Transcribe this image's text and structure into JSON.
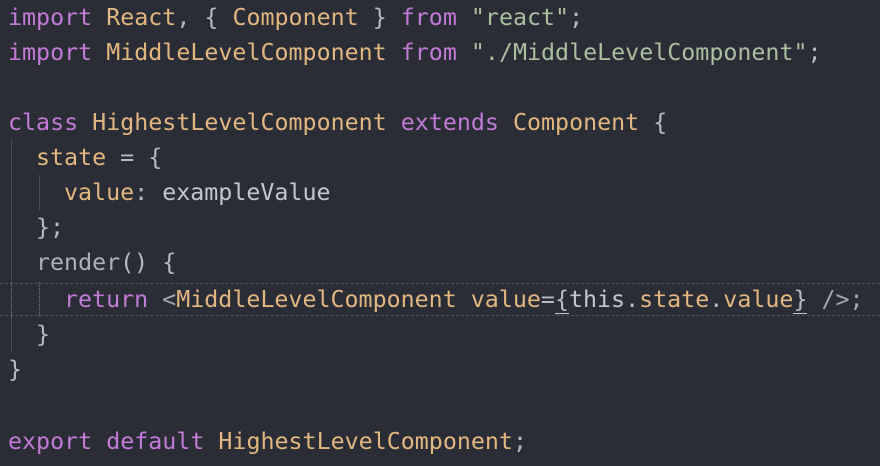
{
  "editor": {
    "lines": [
      {
        "indent": 0,
        "tokens": [
          {
            "t": "import",
            "k": "kw"
          },
          {
            "t": " ",
            "k": "plain"
          },
          {
            "t": "React",
            "k": "cls"
          },
          {
            "t": ", { ",
            "k": "punc"
          },
          {
            "t": "Component",
            "k": "cls"
          },
          {
            "t": " } ",
            "k": "punc"
          },
          {
            "t": "from",
            "k": "kw"
          },
          {
            "t": " ",
            "k": "plain"
          },
          {
            "t": "\"react\"",
            "k": "str"
          },
          {
            "t": ";",
            "k": "punc"
          }
        ]
      },
      {
        "indent": 0,
        "tokens": [
          {
            "t": "import",
            "k": "kw"
          },
          {
            "t": " ",
            "k": "plain"
          },
          {
            "t": "MiddleLevelComponent",
            "k": "cls"
          },
          {
            "t": " ",
            "k": "plain"
          },
          {
            "t": "from",
            "k": "kw"
          },
          {
            "t": " ",
            "k": "plain"
          },
          {
            "t": "\"./MiddleLevelComponent\"",
            "k": "str"
          },
          {
            "t": ";",
            "k": "punc"
          }
        ]
      },
      {
        "indent": 0,
        "tokens": []
      },
      {
        "indent": 0,
        "tokens": [
          {
            "t": "class",
            "k": "kw"
          },
          {
            "t": " ",
            "k": "plain"
          },
          {
            "t": "HighestLevelComponent",
            "k": "cls"
          },
          {
            "t": " ",
            "k": "plain"
          },
          {
            "t": "extends",
            "k": "kw"
          },
          {
            "t": " ",
            "k": "plain"
          },
          {
            "t": "Component",
            "k": "cls"
          },
          {
            "t": " {",
            "k": "punc"
          }
        ]
      },
      {
        "indent": 1,
        "tokens": [
          {
            "t": "state",
            "k": "prop"
          },
          {
            "t": " = {",
            "k": "punc"
          }
        ]
      },
      {
        "indent": 2,
        "tokens": [
          {
            "t": "value",
            "k": "prop"
          },
          {
            "t": ": ",
            "k": "punc"
          },
          {
            "t": "exampleValue",
            "k": "plain"
          }
        ]
      },
      {
        "indent": 1,
        "tokens": [
          {
            "t": "};",
            "k": "punc"
          }
        ]
      },
      {
        "indent": 1,
        "tokens": [
          {
            "t": "render",
            "k": "fn"
          },
          {
            "t": "() {",
            "k": "punc"
          }
        ]
      },
      {
        "indent": 2,
        "active": true,
        "tokens": [
          {
            "t": "return",
            "k": "kw"
          },
          {
            "t": " <",
            "k": "tag"
          },
          {
            "t": "MiddleLevelComponent",
            "k": "cls"
          },
          {
            "t": " ",
            "k": "plain"
          },
          {
            "t": "value",
            "k": "attr"
          },
          {
            "t": "=",
            "k": "punc"
          },
          {
            "t": "{",
            "k": "punc",
            "hl": true
          },
          {
            "t": "this",
            "k": "this"
          },
          {
            "t": ".",
            "k": "punc"
          },
          {
            "t": "state",
            "k": "prop"
          },
          {
            "t": ".",
            "k": "punc"
          },
          {
            "t": "value",
            "k": "prop"
          },
          {
            "t": "}",
            "k": "punc",
            "hl": true
          },
          {
            "t": " />;",
            "k": "tag"
          }
        ]
      },
      {
        "indent": 1,
        "tokens": [
          {
            "t": "}",
            "k": "punc"
          }
        ]
      },
      {
        "indent": 0,
        "tokens": [
          {
            "t": "}",
            "k": "punc"
          }
        ]
      },
      {
        "indent": 0,
        "tokens": []
      },
      {
        "indent": 0,
        "tokens": [
          {
            "t": "export",
            "k": "kw"
          },
          {
            "t": " ",
            "k": "plain"
          },
          {
            "t": "default",
            "k": "kw"
          },
          {
            "t": " ",
            "k": "plain"
          },
          {
            "t": "HighestLevelComponent",
            "k": "cls"
          },
          {
            "t": ";",
            "k": "punc"
          }
        ]
      }
    ]
  },
  "colors": {
    "background": "#2b2d36",
    "keyword": "#c27ad6",
    "class": "#e2b67f",
    "string": "#a9bfa0",
    "text": "#c4c6ce"
  }
}
